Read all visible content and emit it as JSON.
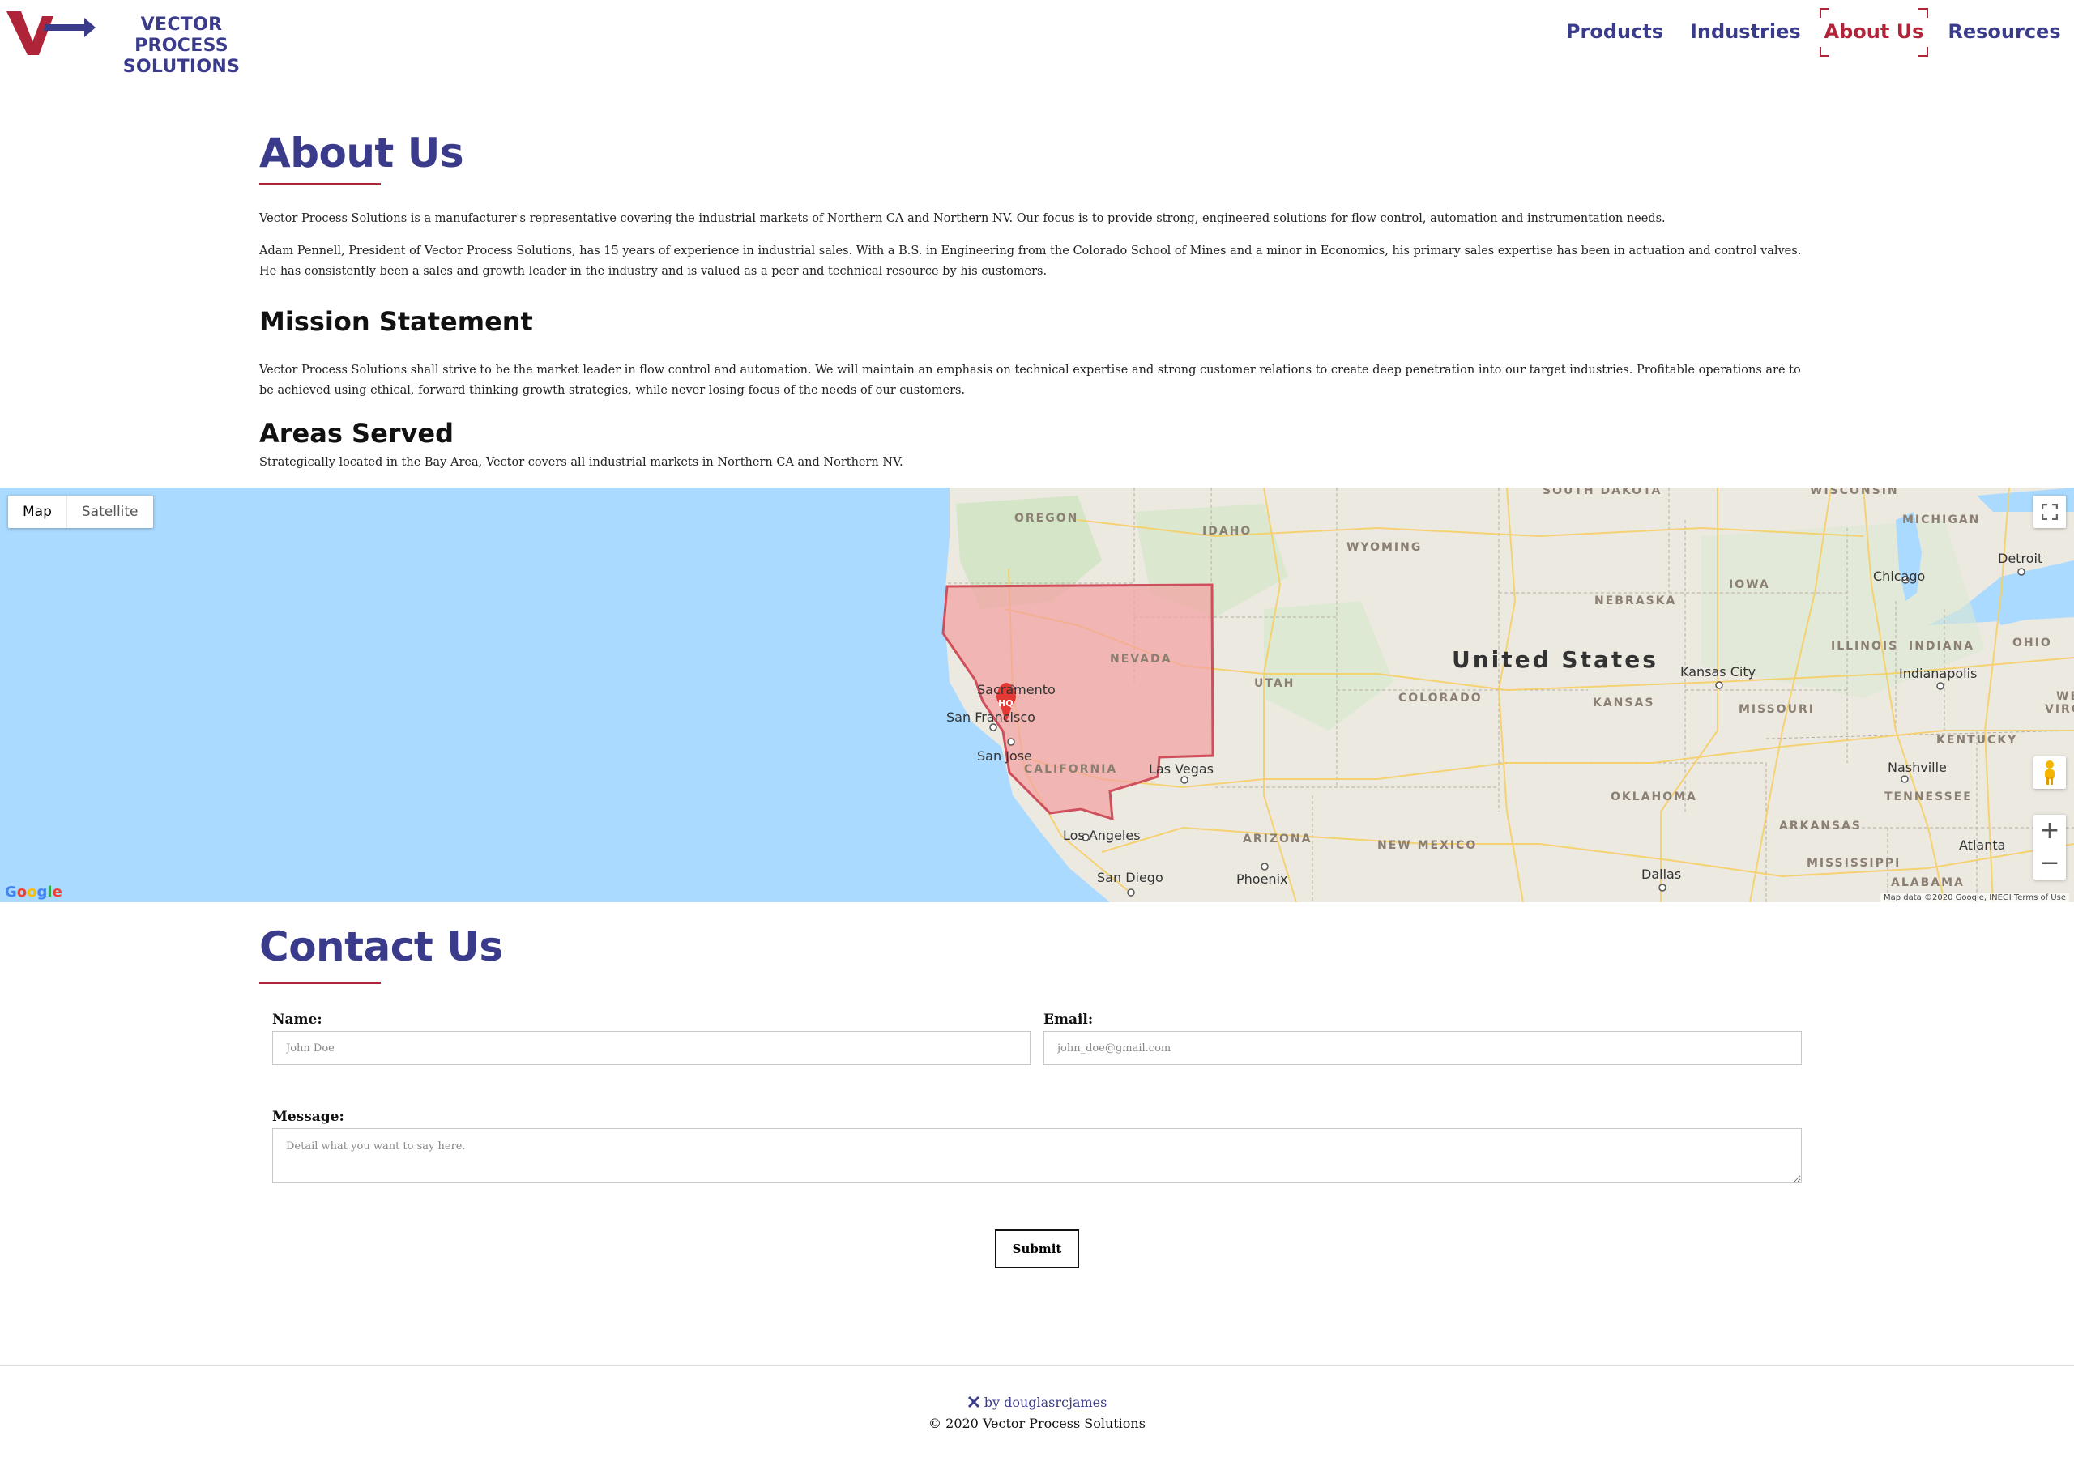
{
  "header": {
    "logo_line1": "VECTOR PROCESS",
    "logo_line2": "SOLUTIONS",
    "nav": [
      {
        "label": "Products"
      },
      {
        "label": "Industries"
      },
      {
        "label": "About Us"
      },
      {
        "label": "Resources"
      }
    ],
    "active_nav": "About Us"
  },
  "about": {
    "title": "About Us",
    "p1": "Vector Process Solutions is a manufacturer's representative covering the industrial markets of Northern CA and Northern NV. Our focus is to provide strong, engineered solutions for flow control, automation and instrumentation needs.",
    "p2": "Adam Pennell, President of Vector Process Solutions, has 15 years of experience in industrial sales. With a B.S. in Engineering from the Colorado School of Mines and a minor in Economics, his primary sales expertise has been in actuation and control valves. He has consistently been a sales and growth leader in the industry and is valued as a peer and technical resource by his customers."
  },
  "mission": {
    "title": "Mission Statement",
    "text": "Vector Process Solutions shall strive to be the market leader in flow control and automation. We will maintain an emphasis on technical expertise and strong customer relations to create deep penetration into our target industries. Profitable operations are to be achieved using ethical, forward thinking growth strategies, while never losing focus of the needs of our customers."
  },
  "areas": {
    "title": "Areas Served",
    "text": "Strategically located in the Bay Area, Vector covers all industrial markets in Northern CA and Northern NV."
  },
  "map": {
    "type_map": "Map",
    "type_satellite": "Satellite",
    "marker_label": "HQ",
    "country": "United States",
    "states": [
      "SOUTH DAKOTA",
      "WISCONSIN",
      "MICHIGAN",
      "OREGON",
      "IDAHO",
      "WYOMING",
      "IOWA",
      "NEBRASKA",
      "NEVADA",
      "UTAH",
      "COLORADO",
      "KANSAS",
      "MISSOURI",
      "ILLINOIS",
      "INDIANA",
      "OHIO",
      "KENTUCKY",
      "CALIFORNIA",
      "OKLAHOMA",
      "TENNESSEE",
      "ARIZONA",
      "NEW MEXICO",
      "ARKANSAS",
      "MISSISSIPPI",
      "ALABAMA",
      "WE",
      "VIRG"
    ],
    "cities": [
      "Detroit",
      "Chicago",
      "Sacramento",
      "San Francisco",
      "San Jose",
      "Las Vegas",
      "Kansas City",
      "Indianapolis",
      "Nashville",
      "Los Angeles",
      "San Diego",
      "Phoenix",
      "Dallas",
      "Atlanta"
    ],
    "google": "Google",
    "attribution": "Map data ©2020 Google, INEGI    Terms of Use",
    "zoom_in": "+",
    "zoom_out": "−"
  },
  "contact": {
    "title": "Contact Us",
    "name_label": "Name:",
    "name_placeholder": "John Doe",
    "email_label": "Email:",
    "email_placeholder": "john_doe@gmail.com",
    "message_label": "Message:",
    "message_placeholder": "Detail what you want to say here.",
    "submit_label": "Submit"
  },
  "footer": {
    "credit": "by douglasrcjames",
    "copyright": "© 2020 Vector Process Solutions"
  },
  "colors": {
    "brand_blue": "#3b3b8c",
    "brand_red": "#b0243a",
    "water": "#aadaff",
    "land": "#ece9e1",
    "region_fill": "#f4a0a0"
  }
}
